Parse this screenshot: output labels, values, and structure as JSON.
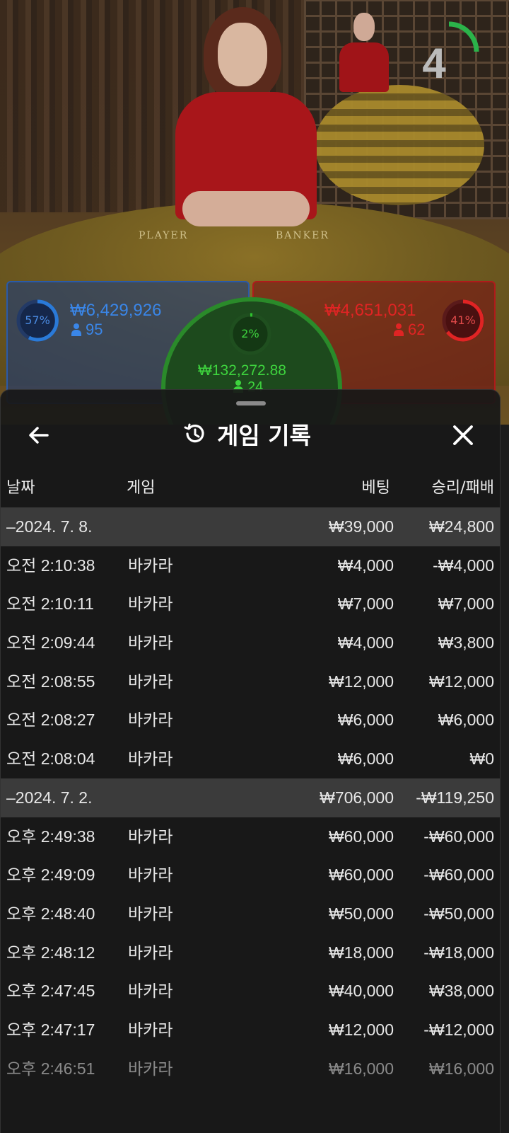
{
  "scene": {
    "table_labels": {
      "player": "PLAYER",
      "banker": "BANKER"
    },
    "timer": {
      "value": "4",
      "color": "#2bb34a"
    }
  },
  "bets": {
    "player": {
      "percent": "57%",
      "amount": "₩6,429,926",
      "count": "95",
      "color": "#2a7ad8"
    },
    "banker": {
      "percent": "41%",
      "amount": "₩4,651,031",
      "count": "62",
      "color": "#e02424"
    },
    "tie": {
      "percent": "2%",
      "amount": "₩132,272.88",
      "count": "24",
      "color": "#2ec42e"
    }
  },
  "history": {
    "title": "게임 기록",
    "icons": {
      "back": "back-arrow-icon",
      "history": "history-icon",
      "close": "close-icon"
    },
    "columns": {
      "date": "날짜",
      "game": "게임",
      "bet": "베팅",
      "result": "승리/패배"
    },
    "rows": [
      {
        "type": "date",
        "time": "–2024. 7. 8.",
        "game": "",
        "bet": "₩39,000",
        "result": "₩24,800"
      },
      {
        "type": "game",
        "time": "오전 2:10:38",
        "game": "바카라",
        "bet": "₩4,000",
        "result": "-₩4,000"
      },
      {
        "type": "game",
        "time": "오전 2:10:11",
        "game": "바카라",
        "bet": "₩7,000",
        "result": "₩7,000"
      },
      {
        "type": "game",
        "time": "오전 2:09:44",
        "game": "바카라",
        "bet": "₩4,000",
        "result": "₩3,800"
      },
      {
        "type": "game",
        "time": "오전 2:08:55",
        "game": "바카라",
        "bet": "₩12,000",
        "result": "₩12,000"
      },
      {
        "type": "game",
        "time": "오전 2:08:27",
        "game": "바카라",
        "bet": "₩6,000",
        "result": "₩6,000"
      },
      {
        "type": "game",
        "time": "오전 2:08:04",
        "game": "바카라",
        "bet": "₩6,000",
        "result": "₩0"
      },
      {
        "type": "date",
        "time": "–2024. 7. 2.",
        "game": "",
        "bet": "₩706,000",
        "result": "-₩119,250"
      },
      {
        "type": "game",
        "time": "오후 2:49:38",
        "game": "바카라",
        "bet": "₩60,000",
        "result": "-₩60,000"
      },
      {
        "type": "game",
        "time": "오후 2:49:09",
        "game": "바카라",
        "bet": "₩60,000",
        "result": "-₩60,000"
      },
      {
        "type": "game",
        "time": "오후 2:48:40",
        "game": "바카라",
        "bet": "₩50,000",
        "result": "-₩50,000"
      },
      {
        "type": "game",
        "time": "오후 2:48:12",
        "game": "바카라",
        "bet": "₩18,000",
        "result": "-₩18,000"
      },
      {
        "type": "game",
        "time": "오후 2:47:45",
        "game": "바카라",
        "bet": "₩40,000",
        "result": "₩38,000"
      },
      {
        "type": "game",
        "time": "오후 2:47:17",
        "game": "바카라",
        "bet": "₩12,000",
        "result": "-₩12,000"
      },
      {
        "type": "game",
        "time": "오후 2:46:51",
        "game": "바카라",
        "bet": "₩16,000",
        "result": "₩16,000"
      }
    ]
  }
}
